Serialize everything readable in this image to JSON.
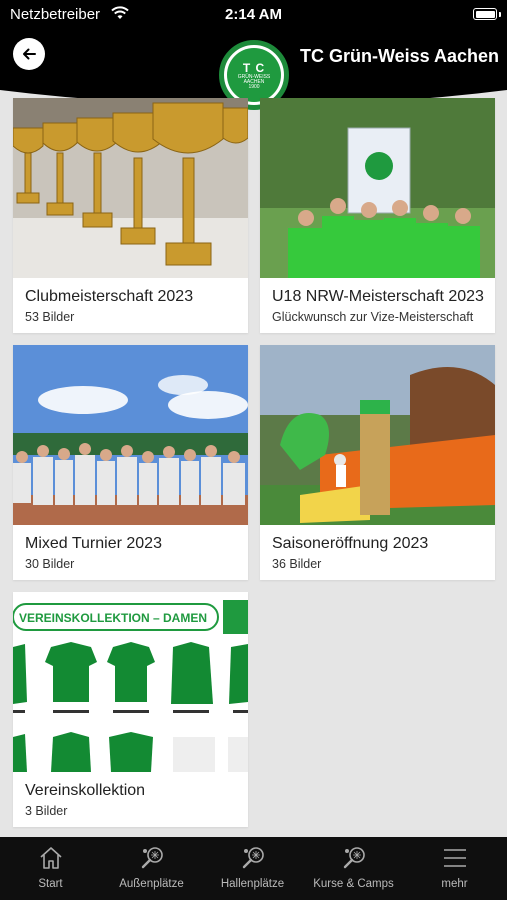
{
  "status_bar": {
    "carrier": "Netzbetreiber",
    "time": "2:14 AM"
  },
  "header": {
    "title": "TC Grün-Weiss Aachen",
    "logo_letters": "T C",
    "logo_text_1": "GRÜN-WEISS",
    "logo_text_2": "AACHEN",
    "logo_year": "1900"
  },
  "albums": [
    {
      "title": "Clubmeisterschaft 2023",
      "subtitle": "53 Bilder"
    },
    {
      "title": "U18 NRW-Meisterschaft 2023",
      "subtitle": "Glückwunsch zur Vize-Meisterschaft"
    },
    {
      "title": "Mixed Turnier 2023",
      "subtitle": "30 Bilder"
    },
    {
      "title": "Saisoneröffnung 2023",
      "subtitle": "36 Bilder"
    },
    {
      "title": "Vereinskollektion",
      "subtitle": "3 Bilder"
    }
  ],
  "collection_banner": "VEREINSKOLLEKTION – DAMEN",
  "tabs": [
    {
      "label": "Start",
      "icon": "home-icon"
    },
    {
      "label": "Außenplätze",
      "icon": "tennis-racket-icon"
    },
    {
      "label": "Hallenplätze",
      "icon": "tennis-racket-icon"
    },
    {
      "label": "Kurse & Camps",
      "icon": "tennis-racket-icon"
    },
    {
      "label": "mehr",
      "icon": "menu-icon"
    }
  ],
  "colors": {
    "brand_green": "#1f9a3f",
    "header_bg": "#000000",
    "tabbar_bg": "#0f0f0f"
  }
}
